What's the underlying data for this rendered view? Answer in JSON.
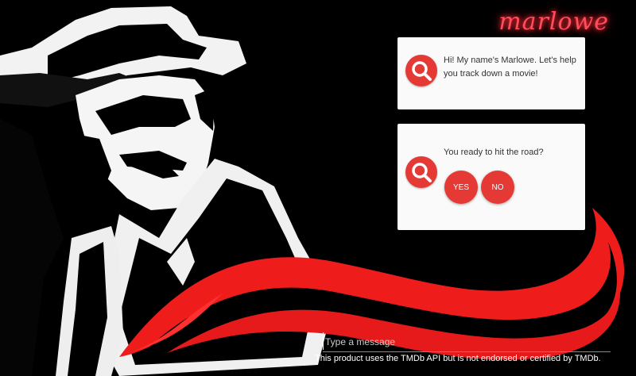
{
  "app": {
    "logo": "marlowe"
  },
  "chat": {
    "messages": [
      {
        "text": "Hi! My name's Marlowe. Let's help you track down a movie!",
        "avatar": "magnifier-icon"
      },
      {
        "text": "You ready to hit the road?",
        "avatar": "magnifier-icon"
      }
    ],
    "quick_replies": [
      "YES",
      "NO"
    ]
  },
  "input": {
    "placeholder": "Type a message",
    "value": ""
  },
  "footer": {
    "disclaimer": "This product uses the TMDb API but is not endorsed or certified by TMDb."
  },
  "colors": {
    "accent": "#e53935",
    "background": "#000000",
    "input_underline": "#1abc9c"
  },
  "background_art": "noir detective silhouette with fedora and red swoosh"
}
